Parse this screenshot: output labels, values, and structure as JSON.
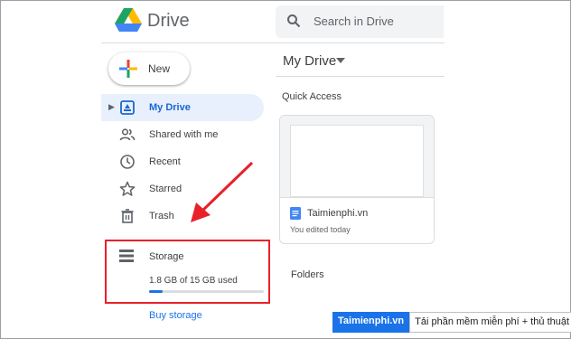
{
  "app": {
    "brand": "Drive",
    "colors": {
      "blue": "#1a73e8",
      "green": "#1ea362",
      "yellow": "#ffba00",
      "red": "#ea4335",
      "highlight": "#e8202a",
      "active_bg": "#e8f0fe"
    }
  },
  "search": {
    "placeholder": "Search in Drive",
    "icon": "search-icon"
  },
  "new_button": {
    "label": "New",
    "icon": "plus-icon"
  },
  "sidebar": {
    "items": [
      {
        "label": "My Drive",
        "icon": "my-drive-icon",
        "active": true
      },
      {
        "label": "Shared with me",
        "icon": "people-icon",
        "active": false
      },
      {
        "label": "Recent",
        "icon": "clock-icon",
        "active": false
      },
      {
        "label": "Starred",
        "icon": "star-icon",
        "active": false
      },
      {
        "label": "Trash",
        "icon": "trash-icon",
        "active": false
      }
    ],
    "storage": {
      "label": "Storage",
      "icon": "storage-icon",
      "usage_text": "1.8 GB of 15 GB used",
      "used_fraction": 0.12,
      "buy_label": "Buy storage"
    }
  },
  "main": {
    "title": "My Drive",
    "quick_access_label": "Quick Access",
    "card": {
      "file_name": "Taimienphi.vn",
      "subtitle": "You edited today",
      "icon": "docs-icon"
    },
    "folders_label": "Folders"
  },
  "watermark": {
    "site": "Taimienphi.vn",
    "tagline": "Tải phần mềm miễn phí + thủ thuật hay"
  }
}
